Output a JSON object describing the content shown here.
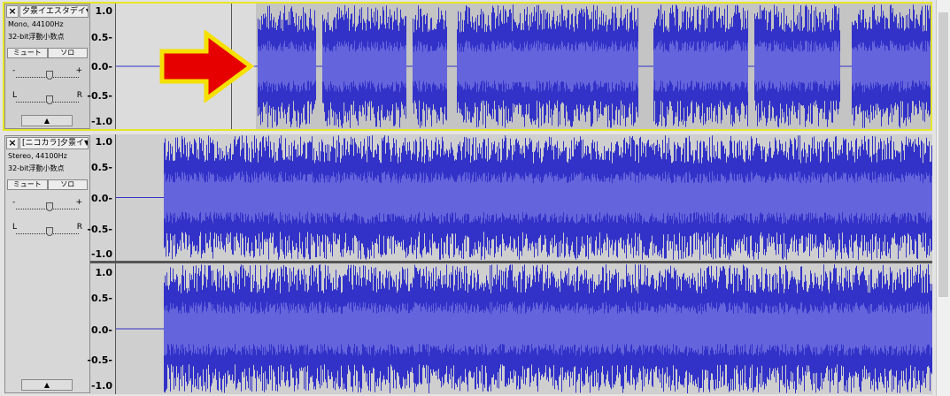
{
  "tracks": [
    {
      "id": "track1",
      "name": "夕景イエスタデイ",
      "info_line1": "Mono, 44100Hz",
      "info_line2": "32-bit浮動小数点",
      "mute_label": "ミュート",
      "solo_label": "ソロ",
      "gain_minus": "-",
      "gain_plus": "+",
      "pan_left": "L",
      "pan_right": "R",
      "ruler_labels": [
        "1.0",
        "0.5-",
        "0.0-",
        "-0.5-",
        "-1.0"
      ],
      "selected": true
    },
    {
      "id": "track2",
      "name": "[ニコカラ]夕景イ",
      "info_line1": "Stereo, 44100Hz",
      "info_line2": "32-bit浮動小数点",
      "mute_label": "ミュート",
      "solo_label": "ソロ",
      "gain_minus": "-",
      "gain_plus": "+",
      "pan_left": "L",
      "pan_right": "R",
      "ruler_labels_ch1": [
        "1.0",
        "0.5-",
        "0.0-",
        "-0.5-",
        "-1.0"
      ],
      "ruler_labels_ch2": [
        "1.0",
        "0.5-",
        "0.0-",
        "-0.5-",
        "-1.0"
      ]
    }
  ],
  "icons": {
    "close": "×",
    "dropdown": "▼",
    "collapse": "▲"
  },
  "colors": {
    "waveform": "#3232c8",
    "waveform_rms": "#6464dc",
    "selection_highlight": "#e6e629",
    "annotation_arrow": "#e60000",
    "arrow_outline": "#f5e000"
  }
}
